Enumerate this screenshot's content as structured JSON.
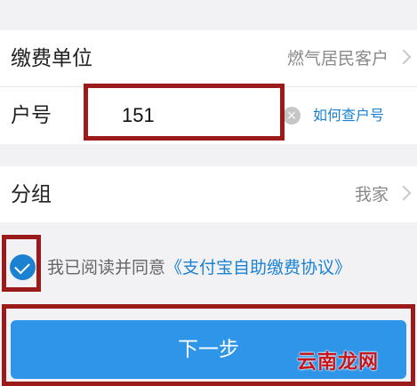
{
  "form": {
    "unit_label": "缴费单位",
    "unit_value": "燃气居民客户",
    "account_label": "户号",
    "account_value": "151",
    "lookup_link": "如何查户号",
    "group_label": "分组",
    "group_value": "我家"
  },
  "agreement": {
    "prefix": "我已阅读并同意",
    "link": "《支付宝自助缴费协议》",
    "checked": true
  },
  "next_button": "下一步",
  "watermark": "云南龙网",
  "colors": {
    "accent": "#2f95e8",
    "link": "#1b82d2",
    "highlight_box": "#9b1b1b",
    "background": "#f2f2f5"
  }
}
